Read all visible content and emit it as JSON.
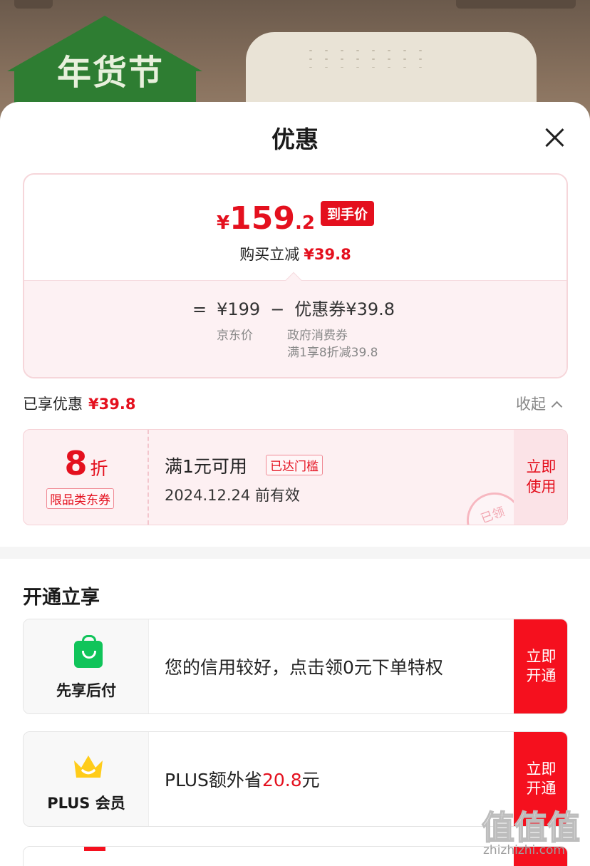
{
  "background": {
    "banner_text": "年货节"
  },
  "sheet": {
    "title": "优惠"
  },
  "price_card": {
    "currency": "¥",
    "price_int": "159",
    "price_dec": ".2",
    "price_tag": "到手价",
    "reduce_label": "购买立减",
    "reduce_value": "¥39.8",
    "formula": {
      "eq": "=",
      "base_price": "¥199",
      "minus": "−",
      "coupon_amount": "优惠券¥39.8",
      "base_label": "京东价",
      "coupon_name": "政府消费券",
      "coupon_rule": "满1享8折减39.8"
    }
  },
  "enjoyed": {
    "label": "已享优惠",
    "value": "¥39.8",
    "collapse_label": "收起"
  },
  "coupon": {
    "discount_num": "8",
    "discount_unit": "折",
    "type": "限品类东券",
    "condition": "满1元可用",
    "reach_badge": "已达门槛",
    "valid_until": "2024.12.24 前有效",
    "use_button": "立即使用",
    "stamp": "已领"
  },
  "section": {
    "title": "开通立享"
  },
  "services": [
    {
      "name": "先享后付",
      "icon": "shopping-bag-icon",
      "desc": "您的信用较好，点击领0元下单特权",
      "button": "立即开通"
    },
    {
      "name": "PLUS 会员",
      "icon": "crown-icon",
      "desc_prefix": "PLUS额外省",
      "desc_amount": "20.8",
      "desc_suffix": "元",
      "button": "立即开通"
    }
  ],
  "watermark": {
    "glyphs": "值值值",
    "domain": "zhizhizhi.com"
  },
  "colors": {
    "accent_red": "#e4101e",
    "button_red": "#f5101e",
    "pink_bg": "#fdf0f2",
    "green": "#10c45a"
  }
}
